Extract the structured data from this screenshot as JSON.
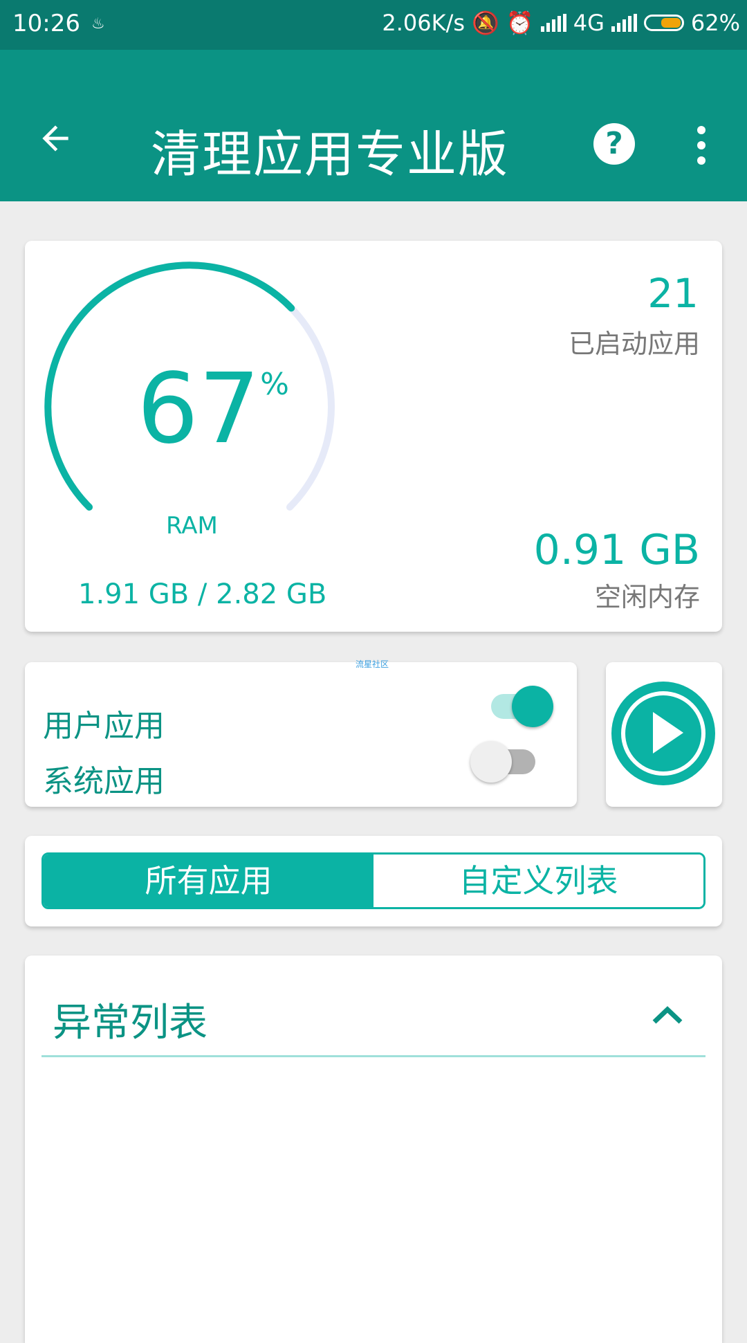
{
  "status_bar": {
    "time": "10:26",
    "speed": "2.06K/s",
    "network": "4G",
    "battery": "62%",
    "battery_level": 0.62
  },
  "app_bar": {
    "title": "清理应用专业版",
    "icons": [
      "back-arrow-icon",
      "help-icon",
      "more-vert-icon"
    ]
  },
  "ram": {
    "percent": "67",
    "percent_symbol": "%",
    "usage_fraction": 0.67,
    "label": "RAM",
    "used": "1.91 GB / 2.82 GB",
    "running_count": "21",
    "running_label": "已启动应用",
    "free": "0.91 GB",
    "free_label": "空闲内存"
  },
  "toggles": {
    "watermark": "流星社区",
    "user_apps": {
      "label": "用户应用",
      "on": true
    },
    "system_apps": {
      "label": "系统应用",
      "on": false
    }
  },
  "segments": {
    "all_apps": "所有应用",
    "custom_list": "自定义列表",
    "selected": "所有应用"
  },
  "anomaly": {
    "title": "异常列表",
    "expanded": true
  },
  "colors": {
    "primary": "#0b9384",
    "accent": "#0bb3a4",
    "status_bar": "#0a7a6f",
    "gauge_track": "#e6eaf8",
    "background": "#ededed"
  }
}
